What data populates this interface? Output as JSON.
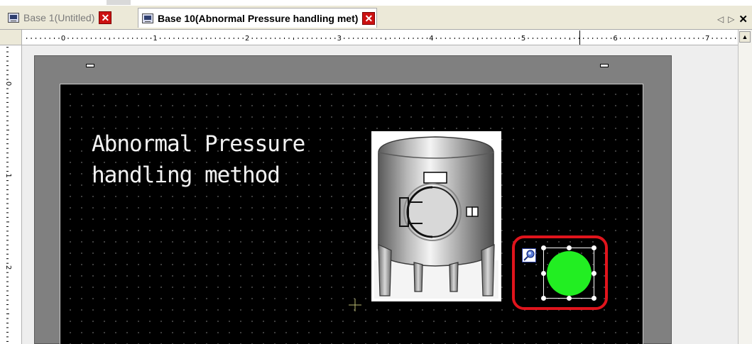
{
  "tabs": [
    {
      "label": "Base 1(Untitled)",
      "active": false,
      "icon": "screen-icon",
      "close": "✕"
    },
    {
      "label": "Base 10(Abnormal Pressure handling met)",
      "active": true,
      "icon": "screen-icon",
      "close": "✕"
    }
  ],
  "tab_nav": {
    "prev": "◁",
    "next": "▷",
    "close": "✕"
  },
  "ruler": {
    "h_labels": [
      "0",
      "1",
      "2",
      "3",
      "4",
      "5",
      "6",
      "7"
    ],
    "v_labels": [
      "0",
      "1",
      "2"
    ]
  },
  "canvas": {
    "text_lines": [
      "Abnormal Pressure",
      "handling method"
    ],
    "lamp_color": "#22ee22",
    "highlight_color": "#e0141c",
    "background": "#000000"
  },
  "scrollbar": {
    "up_arrow": "▲"
  }
}
